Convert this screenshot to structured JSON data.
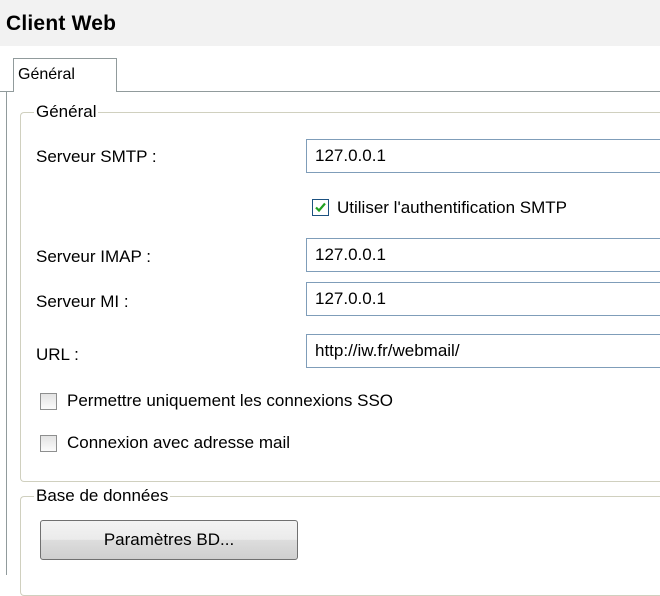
{
  "header": {
    "title": "Client Web"
  },
  "tabs": [
    {
      "label": "Général",
      "selected": true
    }
  ],
  "general_group": {
    "legend": "Général",
    "smtp": {
      "label": "Serveur SMTP :",
      "value": "127.0.0.1"
    },
    "smtp_auth": {
      "label": "Utiliser l'authentification SMTP",
      "checked": true
    },
    "imap": {
      "label": "Serveur IMAP :",
      "value": "127.0.0.1"
    },
    "mi": {
      "label": "Serveur MI :",
      "value": "127.0.0.1"
    },
    "url": {
      "label": "URL :",
      "value": "http://iw.fr/webmail/"
    },
    "sso_only": {
      "label": "Permettre uniquement les connexions SSO",
      "checked": false
    },
    "login_with_email": {
      "label": "Connexion avec adresse mail",
      "checked": false
    }
  },
  "database_group": {
    "legend": "Base de données",
    "db_settings_button": "Paramètres BD..."
  }
}
